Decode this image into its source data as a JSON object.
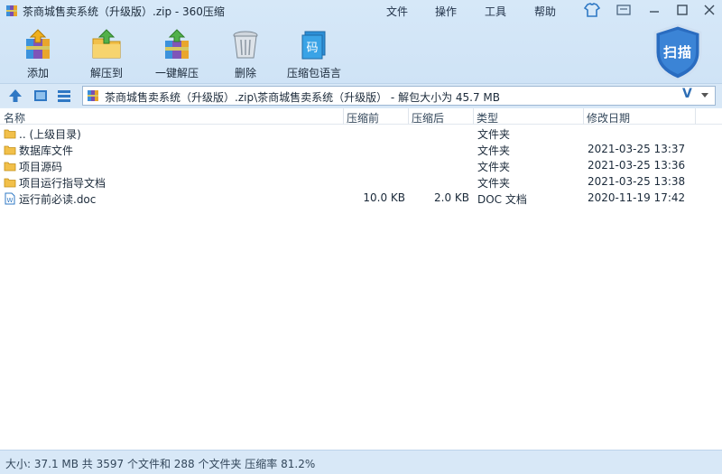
{
  "window": {
    "title": "茶商城售卖系统（升级版）.zip - 360压缩"
  },
  "menubar": {
    "file": "文件",
    "operate": "操作",
    "tools": "工具",
    "help": "帮助"
  },
  "toolbar": {
    "add": "添加",
    "extract_to": "解压到",
    "one_click_extract": "一键解压",
    "delete": "删除",
    "archive_language": "压缩包语言"
  },
  "scan_badge": {
    "label": "扫描"
  },
  "address": {
    "path": "茶商城售卖系统（升级版）.zip\\茶商城售卖系统（升级版） - 解包大小为 45.7 MB"
  },
  "columns": {
    "name": "名称",
    "packed": "压缩前",
    "compressed": "压缩后",
    "type": "类型",
    "modified": "修改日期"
  },
  "rows": [
    {
      "name": ".. (上级目录)",
      "packed": "",
      "compressed": "",
      "type": "文件夹",
      "modified": ""
    },
    {
      "name": "数据库文件",
      "packed": "",
      "compressed": "",
      "type": "文件夹",
      "modified": "2021-03-25 13:37"
    },
    {
      "name": "项目源码",
      "packed": "",
      "compressed": "",
      "type": "文件夹",
      "modified": "2021-03-25 13:36"
    },
    {
      "name": "项目运行指导文档",
      "packed": "",
      "compressed": "",
      "type": "文件夹",
      "modified": "2021-03-25 13:38"
    },
    {
      "name": "运行前必读.doc",
      "packed": "10.0 KB",
      "compressed": "2.0 KB",
      "type": "DOC 文档",
      "modified": "2020-11-19 17:42"
    }
  ],
  "status": {
    "text": "大小: 37.1 MB 共 3597 个文件和 288 个文件夹 压缩率 81.2%"
  },
  "colors": {
    "accent": "#2f78c4",
    "badge": "#2a6cc0",
    "background": "#dcebf8"
  }
}
